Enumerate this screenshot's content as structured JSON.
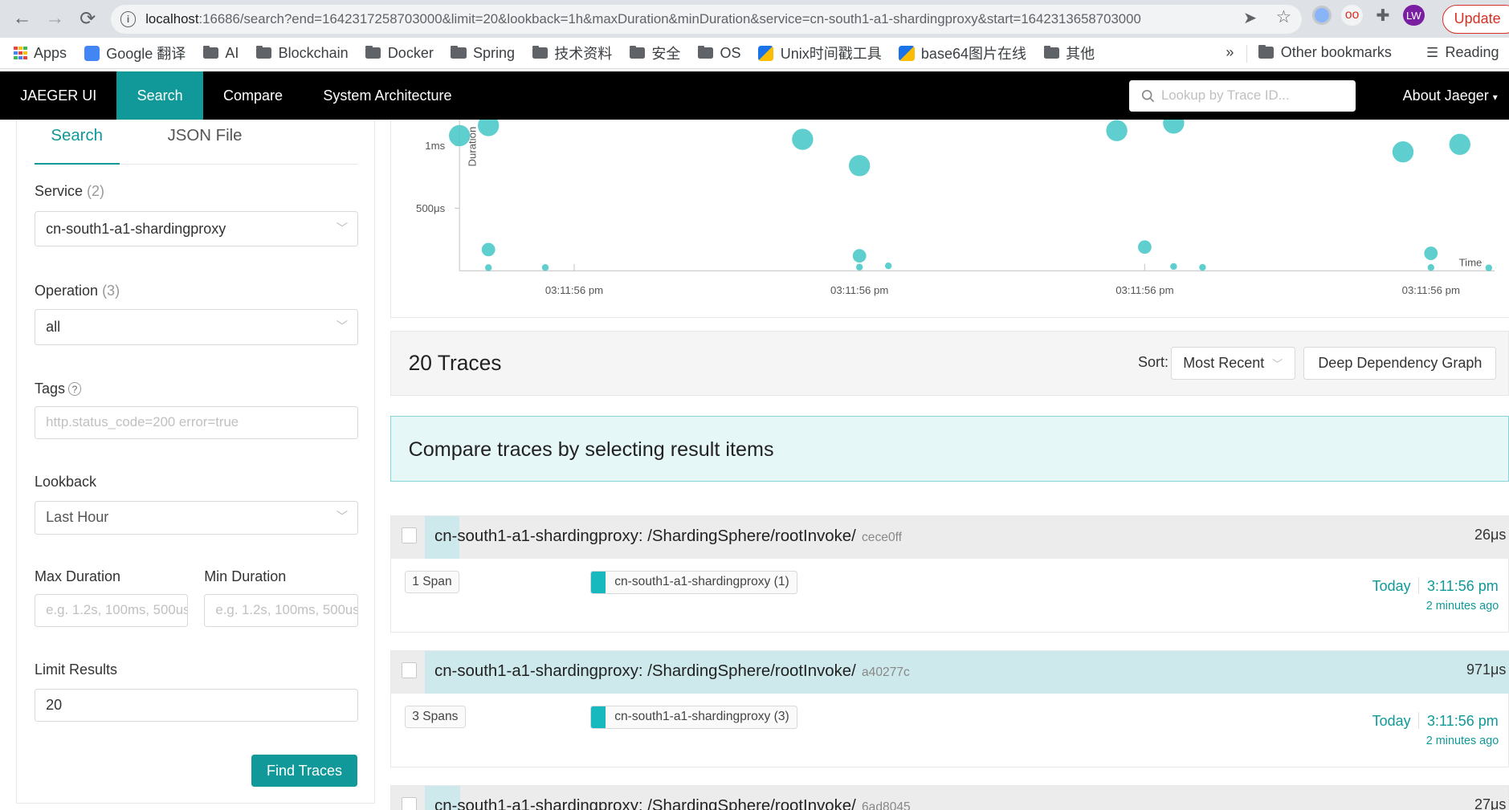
{
  "browser": {
    "url_host": "localhost",
    "url_path": ":16686/search?end=1642317258703000&limit=20&lookback=1h&maxDuration&minDuration&service=cn-south1-a1-shardingproxy&start=1642313658703000",
    "profile_initials": "LW",
    "update_label": "Update",
    "bookmarks": [
      {
        "label": "Apps",
        "icon": "apps-icon"
      },
      {
        "label": "Google 翻译",
        "icon": "google-translate-icon"
      },
      {
        "label": "AI",
        "icon": "folder-icon"
      },
      {
        "label": "Blockchain",
        "icon": "folder-icon"
      },
      {
        "label": "Docker",
        "icon": "folder-icon"
      },
      {
        "label": "Spring",
        "icon": "folder-icon"
      },
      {
        "label": "技术资料",
        "icon": "folder-icon"
      },
      {
        "label": "安全",
        "icon": "folder-icon"
      },
      {
        "label": "OS",
        "icon": "folder-icon"
      },
      {
        "label": "Unix时间戳工具",
        "icon": "bookmark-favicon"
      },
      {
        "label": "base64图片在线",
        "icon": "bookmark-favicon"
      },
      {
        "label": "其他",
        "icon": "folder-icon"
      }
    ],
    "overflow_label": "»",
    "other_bookmarks": "Other bookmarks",
    "reading_list": "Reading"
  },
  "nav": {
    "brand": "JAEGER UI",
    "items": [
      "Search",
      "Compare",
      "System Architecture"
    ],
    "lookup_placeholder": "Lookup by Trace ID...",
    "about": "About Jaeger"
  },
  "search_form": {
    "tabs": [
      "Search",
      "JSON File"
    ],
    "service_label": "Service",
    "service_count": "(2)",
    "service_value": "cn-south1-a1-shardingproxy",
    "operation_label": "Operation",
    "operation_count": "(3)",
    "operation_value": "all",
    "tags_label": "Tags",
    "tags_placeholder": "http.status_code=200 error=true",
    "lookback_label": "Lookback",
    "lookback_value": "Last Hour",
    "max_duration_label": "Max Duration",
    "min_duration_label": "Min Duration",
    "duration_placeholder": "e.g. 1.2s, 100ms, 500us",
    "limit_label": "Limit Results",
    "limit_value": "20",
    "find_button": "Find Traces"
  },
  "chart_data": {
    "type": "scatter",
    "ylabel": "Duration",
    "xlabel": "Time",
    "y_ticks": [
      "1ms",
      "500μs"
    ],
    "x_ticks": [
      "03:11:56 pm",
      "03:11:56 pm",
      "03:11:56 pm",
      "03:11:56 pm"
    ],
    "point_color": "#4ec9c9",
    "points_us": [
      1080,
      1160,
      170,
      26,
      27,
      1050,
      840,
      120,
      30,
      40,
      1120,
      1180,
      190,
      35,
      28,
      950,
      1010,
      140,
      27,
      24
    ]
  },
  "results": {
    "count_label": "20 Traces",
    "sort_label": "Sort:",
    "sort_value": "Most Recent",
    "deep_graph_label": "Deep Dependency Graph",
    "compare_banner": "Compare traces by selecting result items",
    "traces": [
      {
        "title": "cn-south1-a1-shardingproxy: /ShardingSphere/rootInvoke/",
        "id": "cece0ff",
        "duration": "26μs",
        "spans": "1 Span",
        "service": "cn-south1-a1-shardingproxy (1)",
        "day": "Today",
        "time": "3:11:56 pm",
        "ago": "2 minutes ago",
        "bar_fraction": 0.027
      },
      {
        "title": "cn-south1-a1-shardingproxy: /ShardingSphere/rootInvoke/",
        "id": "a40277c",
        "duration": "971μs",
        "spans": "3 Spans",
        "service": "cn-south1-a1-shardingproxy (3)",
        "day": "Today",
        "time": "3:11:56 pm",
        "ago": "2 minutes ago",
        "bar_fraction": 1.0
      },
      {
        "title": "cn-south1-a1-shardingproxy: /ShardingSphere/rootInvoke/",
        "id": "6ad8045",
        "duration": "27μs",
        "spans": "",
        "service": "",
        "day": "",
        "time": "",
        "ago": "",
        "bar_fraction": 0.028
      }
    ]
  }
}
